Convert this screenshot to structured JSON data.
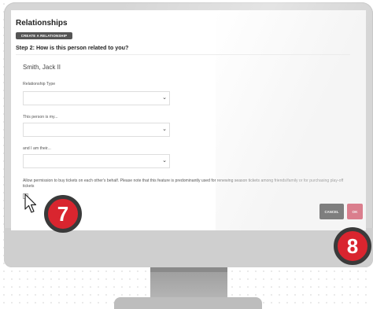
{
  "page": {
    "title": "Relationships",
    "create_button": "CREATE A RELATIONSHIP",
    "step_heading": "Step 2: How is this person related to you?"
  },
  "form": {
    "person_name": "Smith, Jack II",
    "relationship_type_label": "Relationship Type",
    "relationship_type_value": "",
    "this_person_label": "This person is my...",
    "this_person_value": "",
    "i_am_label": "and I am their...",
    "i_am_value": "",
    "permission_text": "Allow permission to buy tickets on each other's behalf. Please note that this feature is predominantly used for renewing season tickets among friends/family or for purchasing play-off tickets",
    "permission_checked": false
  },
  "actions": {
    "cancel_label": "CANCEL",
    "ok_label": "OK"
  },
  "callouts": {
    "step_seven": "7",
    "step_eight": "8"
  },
  "colors": {
    "accent_red": "#c8102e",
    "badge_red": "#d9252f",
    "dark_button": "#111111",
    "monitor_gray": "#d6d6d6"
  },
  "icons": [
    "chevron-down-icon",
    "mouse-cursor-icon"
  ]
}
